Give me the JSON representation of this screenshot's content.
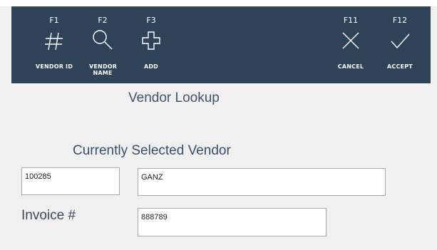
{
  "toolbar": {
    "buttons": [
      {
        "key": "F1",
        "label": "VENDOR ID",
        "icon": "hash-icon"
      },
      {
        "key": "F2",
        "label": "VENDOR NAME",
        "icon": "magnifier-icon"
      },
      {
        "key": "F3",
        "label": "ADD",
        "icon": "plus-icon"
      },
      {
        "key": "F11",
        "label": "CANCEL",
        "icon": "x-icon"
      },
      {
        "key": "F12",
        "label": "ACCEPT",
        "icon": "check-icon"
      }
    ],
    "background": "#2e4357"
  },
  "page": {
    "title": "Vendor Lookup",
    "selected_heading": "Currently Selected Vendor",
    "vendor_id": "100285",
    "vendor_name": "GANZ",
    "invoice_label": "Invoice #",
    "invoice_value": "888789"
  }
}
